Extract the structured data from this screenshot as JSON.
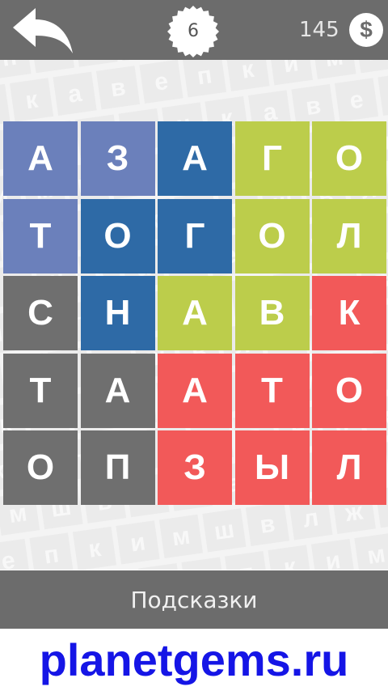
{
  "header": {
    "level": "6",
    "coins": "145",
    "coin_symbol": "$",
    "back_icon": "back-arrow-icon"
  },
  "colors": {
    "topbar": "#6c6c6c",
    "blue_light": "#6b80bb",
    "blue_dark": "#2e6aa6",
    "green": "#bccd4b",
    "red": "#f25959",
    "gray": "#6f6f6f"
  },
  "grid": {
    "rows": 5,
    "cols": 5,
    "cells": [
      {
        "letter": "А",
        "color": "blue_light"
      },
      {
        "letter": "З",
        "color": "blue_light"
      },
      {
        "letter": "А",
        "color": "blue_dark"
      },
      {
        "letter": "Г",
        "color": "green"
      },
      {
        "letter": "О",
        "color": "green"
      },
      {
        "letter": "Т",
        "color": "blue_light"
      },
      {
        "letter": "О",
        "color": "blue_dark"
      },
      {
        "letter": "Г",
        "color": "blue_dark"
      },
      {
        "letter": "О",
        "color": "green"
      },
      {
        "letter": "Л",
        "color": "green"
      },
      {
        "letter": "С",
        "color": "gray"
      },
      {
        "letter": "Н",
        "color": "blue_dark"
      },
      {
        "letter": "А",
        "color": "green"
      },
      {
        "letter": "В",
        "color": "green"
      },
      {
        "letter": "К",
        "color": "red"
      },
      {
        "letter": "Т",
        "color": "gray"
      },
      {
        "letter": "А",
        "color": "gray"
      },
      {
        "letter": "А",
        "color": "red"
      },
      {
        "letter": "Т",
        "color": "red"
      },
      {
        "letter": "О",
        "color": "red"
      },
      {
        "letter": "О",
        "color": "gray"
      },
      {
        "letter": "П",
        "color": "gray"
      },
      {
        "letter": "З",
        "color": "red"
      },
      {
        "letter": "Ы",
        "color": "red"
      },
      {
        "letter": "Л",
        "color": "red"
      }
    ]
  },
  "hints_label": "Подсказки",
  "watermark": "planetgems.ru",
  "background_letters": [
    "в",
    "е",
    "п",
    "к",
    "и",
    "м",
    "ш",
    "в",
    "л",
    "ж",
    "а",
    "т",
    "н",
    "к",
    "а"
  ]
}
